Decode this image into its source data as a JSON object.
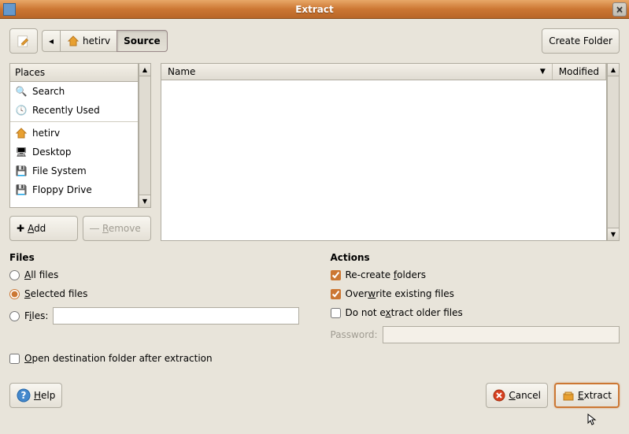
{
  "titlebar": {
    "title": "Extract",
    "close": "×"
  },
  "top": {
    "back": "◂",
    "home_label": "hetirv",
    "current_label": "Source",
    "create_folder": "Create Folder"
  },
  "places": {
    "header": "Places",
    "items": [
      {
        "icon": "search-icon",
        "label": "Search"
      },
      {
        "icon": "recent-icon",
        "label": "Recently Used"
      },
      {
        "icon": "home-icon",
        "label": "hetirv"
      },
      {
        "icon": "desktop-icon",
        "label": "Desktop"
      },
      {
        "icon": "drive-icon",
        "label": "File System"
      },
      {
        "icon": "floppy-icon",
        "label": "Floppy Drive"
      }
    ],
    "add": "Add",
    "remove": "Remove"
  },
  "filelist": {
    "col_name": "Name",
    "col_modified": "Modified"
  },
  "files_section": {
    "title": "Files",
    "all": "All files",
    "selected": "Selected files",
    "pattern": "Files:",
    "selected_radio": "selected"
  },
  "actions_section": {
    "title": "Actions",
    "recreate": "Re-create folders",
    "overwrite": "Overwrite existing files",
    "noolder": "Do not extract older files",
    "password_label": "Password:",
    "recreate_checked": true,
    "overwrite_checked": true,
    "noolder_checked": false
  },
  "open_dest": {
    "label": "Open destination folder after extraction",
    "checked": false
  },
  "buttons": {
    "help": "Help",
    "cancel": "Cancel",
    "extract": "Extract"
  }
}
